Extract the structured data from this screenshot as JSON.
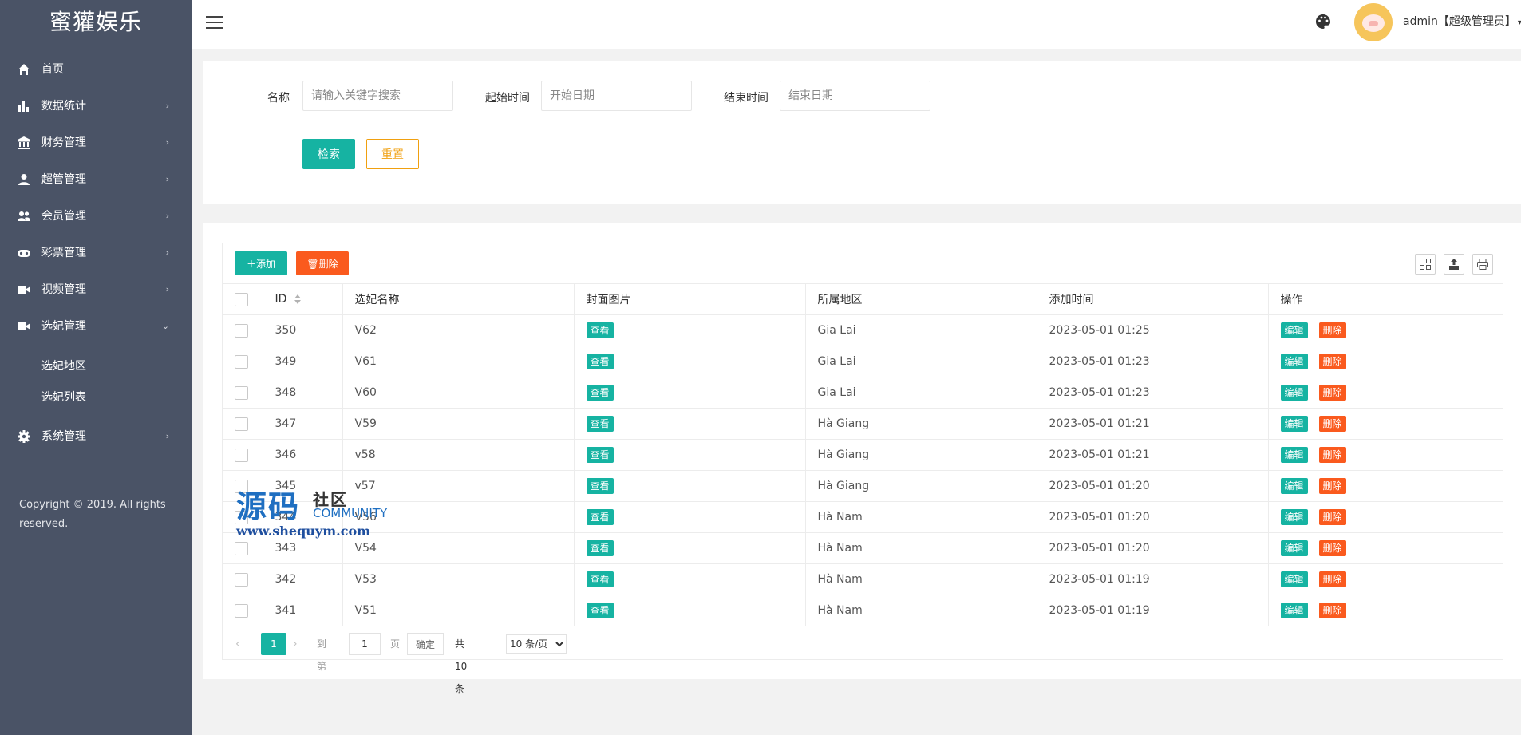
{
  "sidebar": {
    "logo": "蜜獾娱乐",
    "items": [
      {
        "label": "首页",
        "icon": "home-icon",
        "arrow": ""
      },
      {
        "label": "数据统计",
        "icon": "bar-chart-icon",
        "arrow": "›"
      },
      {
        "label": "财务管理",
        "icon": "bank-icon",
        "arrow": "›"
      },
      {
        "label": "超管管理",
        "icon": "user-icon",
        "arrow": "›"
      },
      {
        "label": "会员管理",
        "icon": "users-icon",
        "arrow": "›"
      },
      {
        "label": "彩票管理",
        "icon": "gamepad-icon",
        "arrow": "›"
      },
      {
        "label": "视频管理",
        "icon": "video-camera-icon",
        "arrow": "›"
      },
      {
        "label": "选妃管理",
        "icon": "video-camera-icon",
        "arrow": "⌄"
      }
    ],
    "sub_items": [
      "选妃地区",
      "选妃列表"
    ],
    "system": {
      "label": "系统管理",
      "icon": "gear-icon",
      "arrow": "›"
    },
    "copyright": "Copyright © 2019. All rights reserved."
  },
  "header": {
    "user_label": "admin【超级管理员】",
    "caret": "▾"
  },
  "search": {
    "name_label": "名称",
    "name_placeholder": "请输入关键字搜索",
    "start_label": "起始时间",
    "start_placeholder": "开始日期",
    "end_label": "结束时间",
    "end_placeholder": "结束日期",
    "search_button": "检索",
    "reset_button": "重置"
  },
  "toolbar": {
    "add_label": "添加",
    "delete_label": "删除"
  },
  "table": {
    "columns": [
      "ID",
      "选妃名称",
      "封面图片",
      "所属地区",
      "添加时间",
      "操作"
    ],
    "view_label": "查看",
    "edit_label": "编辑",
    "delete_label": "删除",
    "rows": [
      {
        "id": "350",
        "name": "V62",
        "region": "Gia Lai",
        "time": "2023-05-01 01:25"
      },
      {
        "id": "349",
        "name": "V61",
        "region": "Gia Lai",
        "time": "2023-05-01 01:23"
      },
      {
        "id": "348",
        "name": "V60",
        "region": "Gia Lai",
        "time": "2023-05-01 01:23"
      },
      {
        "id": "347",
        "name": "V59",
        "region": "Hà Giang",
        "time": "2023-05-01 01:21"
      },
      {
        "id": "346",
        "name": "v58",
        "region": "Hà Giang",
        "time": "2023-05-01 01:21"
      },
      {
        "id": "345",
        "name": "v57",
        "region": "Hà Giang",
        "time": "2023-05-01 01:20"
      },
      {
        "id": "344",
        "name": "V56",
        "region": "Hà Nam",
        "time": "2023-05-01 01:20"
      },
      {
        "id": "343",
        "name": "V54",
        "region": "Hà Nam",
        "time": "2023-05-01 01:20"
      },
      {
        "id": "342",
        "name": "V53",
        "region": "Hà Nam",
        "time": "2023-05-01 01:19"
      },
      {
        "id": "341",
        "name": "V51",
        "region": "Hà Nam",
        "time": "2023-05-01 01:19"
      }
    ]
  },
  "pager": {
    "prev": "‹",
    "current": "1",
    "next": "›",
    "goto_label": "到第",
    "goto_value": "1",
    "page_unit": "页",
    "confirm": "确定",
    "total": "共 10 条",
    "page_size": "10 条/页"
  },
  "watermark": {
    "main": "源码",
    "she": "社区",
    "community": "COMMUNITY",
    "url": "www.shequym.com"
  },
  "colors": {
    "sidebar_bg": "#4a5366",
    "primary": "#16b3a2",
    "danger": "#fa5a1e",
    "warning": "#f0a010"
  }
}
